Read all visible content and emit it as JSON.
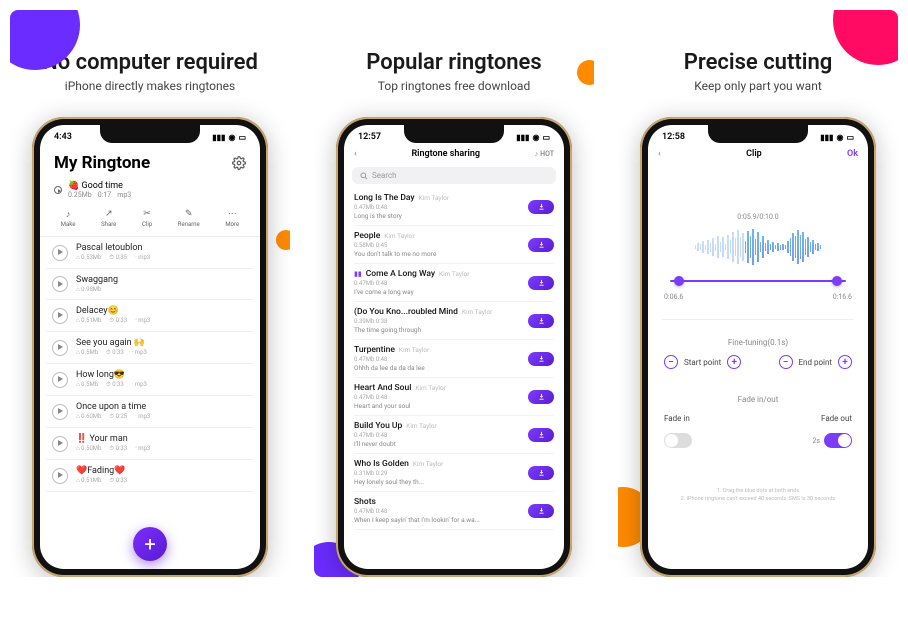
{
  "panel1": {
    "heading": "No computer required",
    "subheading": "iPhone directly makes ringtones",
    "time": "4:43",
    "title": "My Ringtone",
    "now_playing": {
      "title": "🍓 Good time",
      "size": "0.25Mb",
      "dur": "0:17",
      "fmt": "mp3"
    },
    "tools": [
      {
        "label": "Make"
      },
      {
        "label": "Share"
      },
      {
        "label": "Clip"
      },
      {
        "label": "Rename"
      },
      {
        "label": "More"
      }
    ],
    "rows": [
      {
        "title": "Pascal letoublon",
        "size": "0.53Mb",
        "dur": "0:35",
        "fmt": "mp3"
      },
      {
        "title": "Swaggang",
        "size": "0.98Mb",
        "dur": "",
        "fmt": ""
      },
      {
        "title": "Delacey😊",
        "size": "0.51Mb",
        "dur": "0:33",
        "fmt": "mp3"
      },
      {
        "title": "See you again 🙌",
        "size": "0.5Mb",
        "dur": "0:33",
        "fmt": "mp3"
      },
      {
        "title": "How long😎",
        "size": "0.5Mb",
        "dur": "0:33",
        "fmt": "mp3"
      },
      {
        "title": "Once upon a time",
        "size": "0.60Mb",
        "dur": "0:25",
        "fmt": "mp3"
      },
      {
        "title": "‼️ Your man",
        "size": "0.50Mb",
        "dur": "0:33",
        "fmt": "mp3"
      },
      {
        "title": "❤️Fading❤️",
        "size": "0.51Mb",
        "dur": "0:33",
        "fmt": ""
      }
    ]
  },
  "panel2": {
    "heading": "Popular ringtones",
    "subheading": "Top ringtones free download",
    "time": "12:57",
    "nav_title": "Ringtone sharing",
    "nav_hot": "HOT",
    "search_placeholder": "Search",
    "songs": [
      {
        "title": "Long Is The Day",
        "artist": "Kim Taylor",
        "size": "0.47Mb",
        "dur": "0:48",
        "desc": "Long is the story"
      },
      {
        "title": "People",
        "artist": "Kim Taylor",
        "size": "0.58Mb",
        "dur": "0:45",
        "desc": "You don't talk to me no more"
      },
      {
        "title": "Come A Long Way",
        "artist": "Kim Taylor",
        "size": "0.47Mb",
        "dur": "0:48",
        "desc": "I've come a long way",
        "playing": true
      },
      {
        "title": "(Do You Kno...roubled Mind",
        "artist": "Kim Taylor",
        "size": "0.39Mb",
        "dur": "0:38",
        "desc": "The time going through"
      },
      {
        "title": "Turpentine",
        "artist": "Kim Taylor",
        "size": "0.47Mb",
        "dur": "0:48",
        "desc": "Ohhh da lee da da da lee"
      },
      {
        "title": "Heart And Soul",
        "artist": "Kim Taylor",
        "size": "0.47Mb",
        "dur": "0:48",
        "desc": "Heart and your soul"
      },
      {
        "title": "Build You Up",
        "artist": "Kim Taylor",
        "size": "0.47Mb",
        "dur": "0:48",
        "desc": "I'll never doubt"
      },
      {
        "title": "Who Is Golden",
        "artist": "Kim Taylor",
        "size": "0.31Mb",
        "dur": "0:29",
        "desc": "Hey lonely soul they th..."
      },
      {
        "title": "Shots",
        "artist": "",
        "size": "0.47Mb",
        "dur": "0:48",
        "desc": "When I keep sayin' that I'm lookin' for a wa..."
      }
    ]
  },
  "panel3": {
    "heading": "Precise cutting",
    "subheading": "Keep only part you want",
    "time": "12:58",
    "nav_title": "Clip",
    "nav_back": "‹",
    "nav_ok": "Ok",
    "clip_time": "0:05.9/0:10.0",
    "t_start": "0:06.6",
    "t_end": "0:16.6",
    "fine_label": "Fine-tuning(0.1s)",
    "start_label": "Start point",
    "end_label": "End point",
    "fade_header": "Fade in/out",
    "fade_in_label": "Fade in",
    "fade_out_label": "Fade out",
    "fade_out_val": "2s",
    "footer1": "1. Drag the blue dots at both ends",
    "footer2": "2. iPhone ringtone can't exceed 40 seconds, SMS is 30 seconds"
  }
}
